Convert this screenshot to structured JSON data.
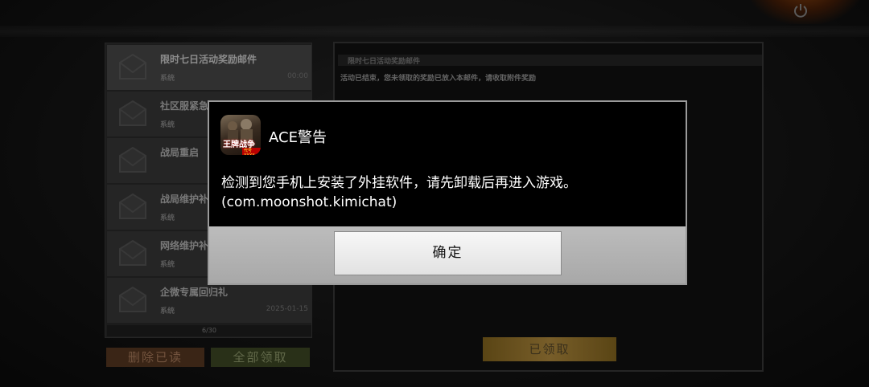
{
  "colors": {
    "delete_button_bg": "#5a3a22",
    "claim_all_button_bg": "#3f4a26",
    "claimed_button_bg": "#b89040",
    "dialog_bg": "#000000",
    "dialog_footer_bg": "#b0b0b0"
  },
  "top": {
    "power_icon": "power-icon"
  },
  "mail_list": {
    "items": [
      {
        "title": "限时七日活动奖励邮件",
        "sender": "系统",
        "date": "00:00",
        "active": true
      },
      {
        "title": "社区服紧急维护补偿",
        "sender": "系统",
        "date": "",
        "active": false
      },
      {
        "title": "战局重启",
        "sender": "",
        "date": "",
        "active": false
      },
      {
        "title": "战局维护补偿",
        "sender": "系统",
        "date": "",
        "active": false
      },
      {
        "title": "网络维护补偿",
        "sender": "系统",
        "date": "",
        "active": false
      },
      {
        "title": "企微专属回归礼",
        "sender": "系统",
        "date": "2025-01-15",
        "active": false
      }
    ],
    "page_indicator": "6/30",
    "delete_read_label": "删除已读",
    "claim_all_label": "全部领取"
  },
  "detail": {
    "title": "限时七日活动奖励邮件",
    "body": "活动已结束，您未领取的奖励已放入本邮件，请收取附件奖励",
    "claimed_label": "已领取"
  },
  "dialog": {
    "title": "ACE警告",
    "app_icon_text": "王牌战争",
    "app_icon_badge": "代号XXXX",
    "message_line1": "检测到您手机上安装了外挂软件，请先卸载后再进入游戏。",
    "message_line2": "(com.moonshot.kimichat)",
    "confirm_label": "确定"
  }
}
